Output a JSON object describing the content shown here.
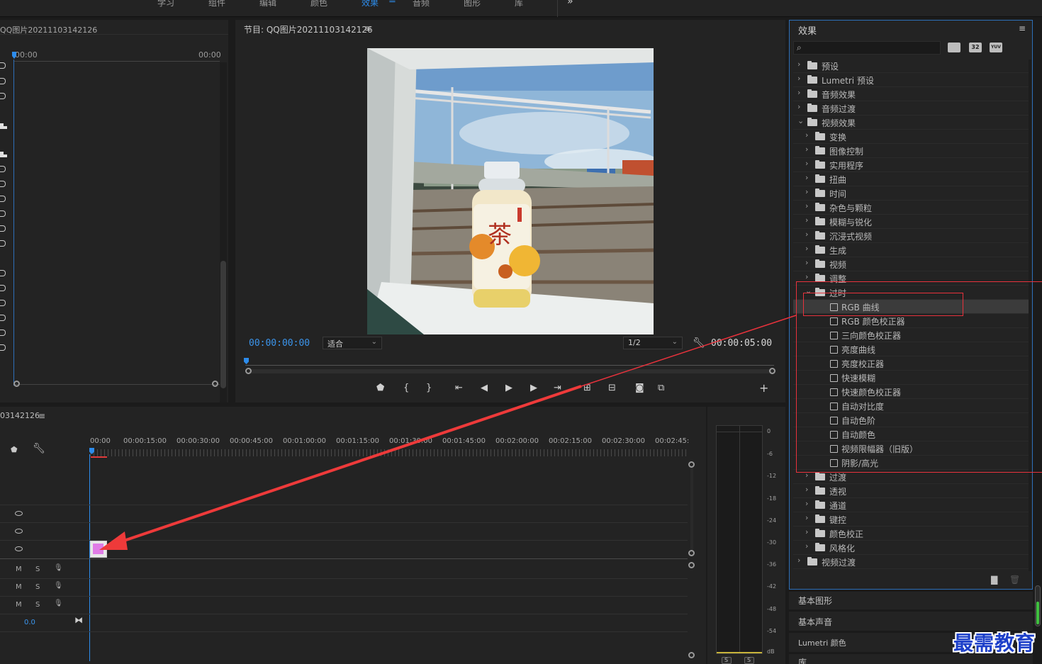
{
  "workspace_tabs": [
    {
      "label": "学习"
    },
    {
      "label": "组件"
    },
    {
      "label": "编辑"
    },
    {
      "label": "颜色"
    },
    {
      "label": "效果"
    },
    {
      "label": "音频"
    },
    {
      "label": "图形"
    },
    {
      "label": "库"
    }
  ],
  "workspace_more": "»",
  "workspace_menu": "≡",
  "source": {
    "title": "QQ图片20211103142126",
    "tc_left": "00:00",
    "tc_right": "00:00"
  },
  "program": {
    "title": "节目: QQ图片20211103142126",
    "menu": "≡",
    "timecode_current": "00:00:00:00",
    "fit_label": "适合",
    "resolution": "1/2",
    "timecode_duration": "00:00:05:00"
  },
  "timeline": {
    "title": "03142126",
    "menu": "≡",
    "ruler": [
      "00:00",
      "00:00:15:00",
      "00:00:30:00",
      "00:00:45:00",
      "00:01:00:00",
      "00:01:15:00",
      "00:01:30:00",
      "00:01:45:00",
      "00:02:00:00",
      "00:02:15:00",
      "00:02:30:00",
      "00:02:45:"
    ],
    "audio_m": "M",
    "audio_s": "S",
    "volume": "0.0"
  },
  "effects": {
    "title": "效果",
    "menu": "≡",
    "search_placeholder": "",
    "filter_32": "32",
    "filter_yuv": "YUV",
    "tree": [
      {
        "label": "预设",
        "level": 0,
        "type": "preset",
        "open": false
      },
      {
        "label": "Lumetri 预设",
        "level": 0,
        "type": "preset",
        "open": false
      },
      {
        "label": "音频效果",
        "level": 0,
        "type": "folder",
        "open": false
      },
      {
        "label": "音频过渡",
        "level": 0,
        "type": "folder",
        "open": false
      },
      {
        "label": "视频效果",
        "level": 0,
        "type": "folder",
        "open": true
      },
      {
        "label": "变换",
        "level": 1,
        "type": "folder",
        "open": false
      },
      {
        "label": "图像控制",
        "level": 1,
        "type": "folder",
        "open": false
      },
      {
        "label": "实用程序",
        "level": 1,
        "type": "folder",
        "open": false
      },
      {
        "label": "扭曲",
        "level": 1,
        "type": "folder",
        "open": false
      },
      {
        "label": "时间",
        "level": 1,
        "type": "folder",
        "open": false
      },
      {
        "label": "杂色与颗粒",
        "level": 1,
        "type": "folder",
        "open": false
      },
      {
        "label": "模糊与锐化",
        "level": 1,
        "type": "folder",
        "open": false
      },
      {
        "label": "沉浸式视频",
        "level": 1,
        "type": "folder",
        "open": false
      },
      {
        "label": "生成",
        "level": 1,
        "type": "folder",
        "open": false
      },
      {
        "label": "视频",
        "level": 1,
        "type": "folder",
        "open": false
      },
      {
        "label": "调整",
        "level": 1,
        "type": "folder",
        "open": false
      },
      {
        "label": "过时",
        "level": 1,
        "type": "folder",
        "open": true
      },
      {
        "label": "RGB 曲线",
        "level": 2,
        "type": "effect",
        "selected": true
      },
      {
        "label": "RGB 颜色校正器",
        "level": 2,
        "type": "effect"
      },
      {
        "label": "三向颜色校正器",
        "level": 2,
        "type": "effect"
      },
      {
        "label": "亮度曲线",
        "level": 2,
        "type": "effect"
      },
      {
        "label": "亮度校正器",
        "level": 2,
        "type": "effect"
      },
      {
        "label": "快速模糊",
        "level": 2,
        "type": "effect"
      },
      {
        "label": "快速颜色校正器",
        "level": 2,
        "type": "effect"
      },
      {
        "label": "自动对比度",
        "level": 2,
        "type": "effect"
      },
      {
        "label": "自动色阶",
        "level": 2,
        "type": "effect"
      },
      {
        "label": "自动颜色",
        "level": 2,
        "type": "effect"
      },
      {
        "label": "视频限幅器（旧版）",
        "level": 2,
        "type": "effect"
      },
      {
        "label": "阴影/高光",
        "level": 2,
        "type": "effect"
      },
      {
        "label": "过渡",
        "level": 1,
        "type": "folder",
        "open": false
      },
      {
        "label": "透视",
        "level": 1,
        "type": "folder",
        "open": false
      },
      {
        "label": "通道",
        "level": 1,
        "type": "folder",
        "open": false
      },
      {
        "label": "键控",
        "level": 1,
        "type": "folder",
        "open": false
      },
      {
        "label": "颜色校正",
        "level": 1,
        "type": "folder",
        "open": false
      },
      {
        "label": "风格化",
        "level": 1,
        "type": "folder",
        "open": false
      },
      {
        "label": "视频过渡",
        "level": 0,
        "type": "folder",
        "open": false
      }
    ]
  },
  "side_panels": [
    {
      "label": "基本图形"
    },
    {
      "label": "基本声音"
    },
    {
      "label": "Lumetri 颜色"
    },
    {
      "label": "库"
    }
  ],
  "audio_meter": {
    "scale": [
      "0",
      "-6",
      "-12",
      "-18",
      "-24",
      "-30",
      "-36",
      "-42",
      "-48",
      "-54",
      "dB"
    ],
    "solo_left": "S",
    "solo_right": "S"
  },
  "watermark": "最需教育",
  "colors": {
    "accent": "#2d8ceb",
    "highlight": "#e8323c",
    "clip": "#e07ce6"
  }
}
